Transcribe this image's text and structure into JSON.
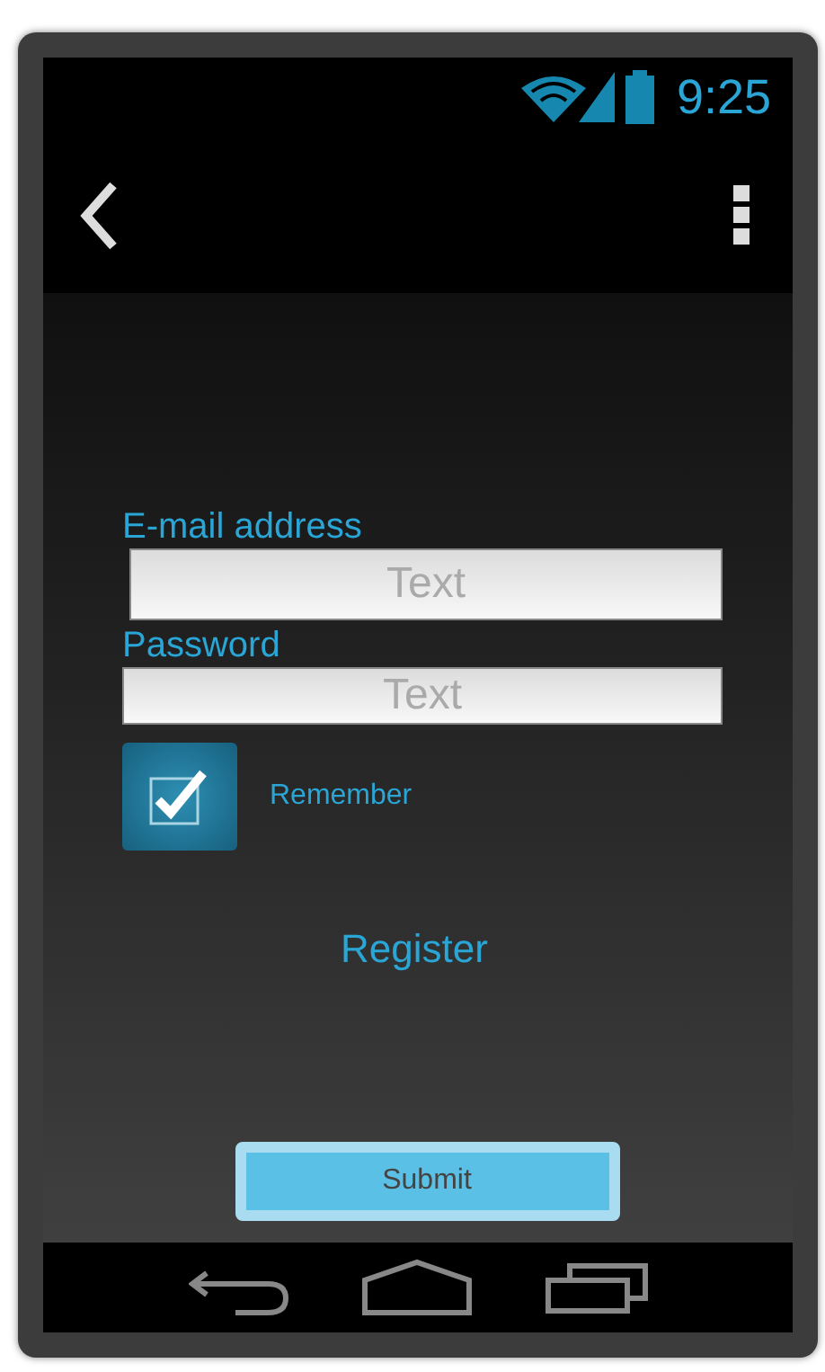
{
  "status_bar": {
    "time": "9:25"
  },
  "form": {
    "fields": [
      {
        "label": "E-mail address",
        "placeholder": "Text"
      },
      {
        "label": "Password",
        "placeholder": "Text"
      }
    ],
    "remember": {
      "label": "Remember",
      "checked": true
    },
    "register_link": "Register",
    "submit_button": "Submit"
  }
}
